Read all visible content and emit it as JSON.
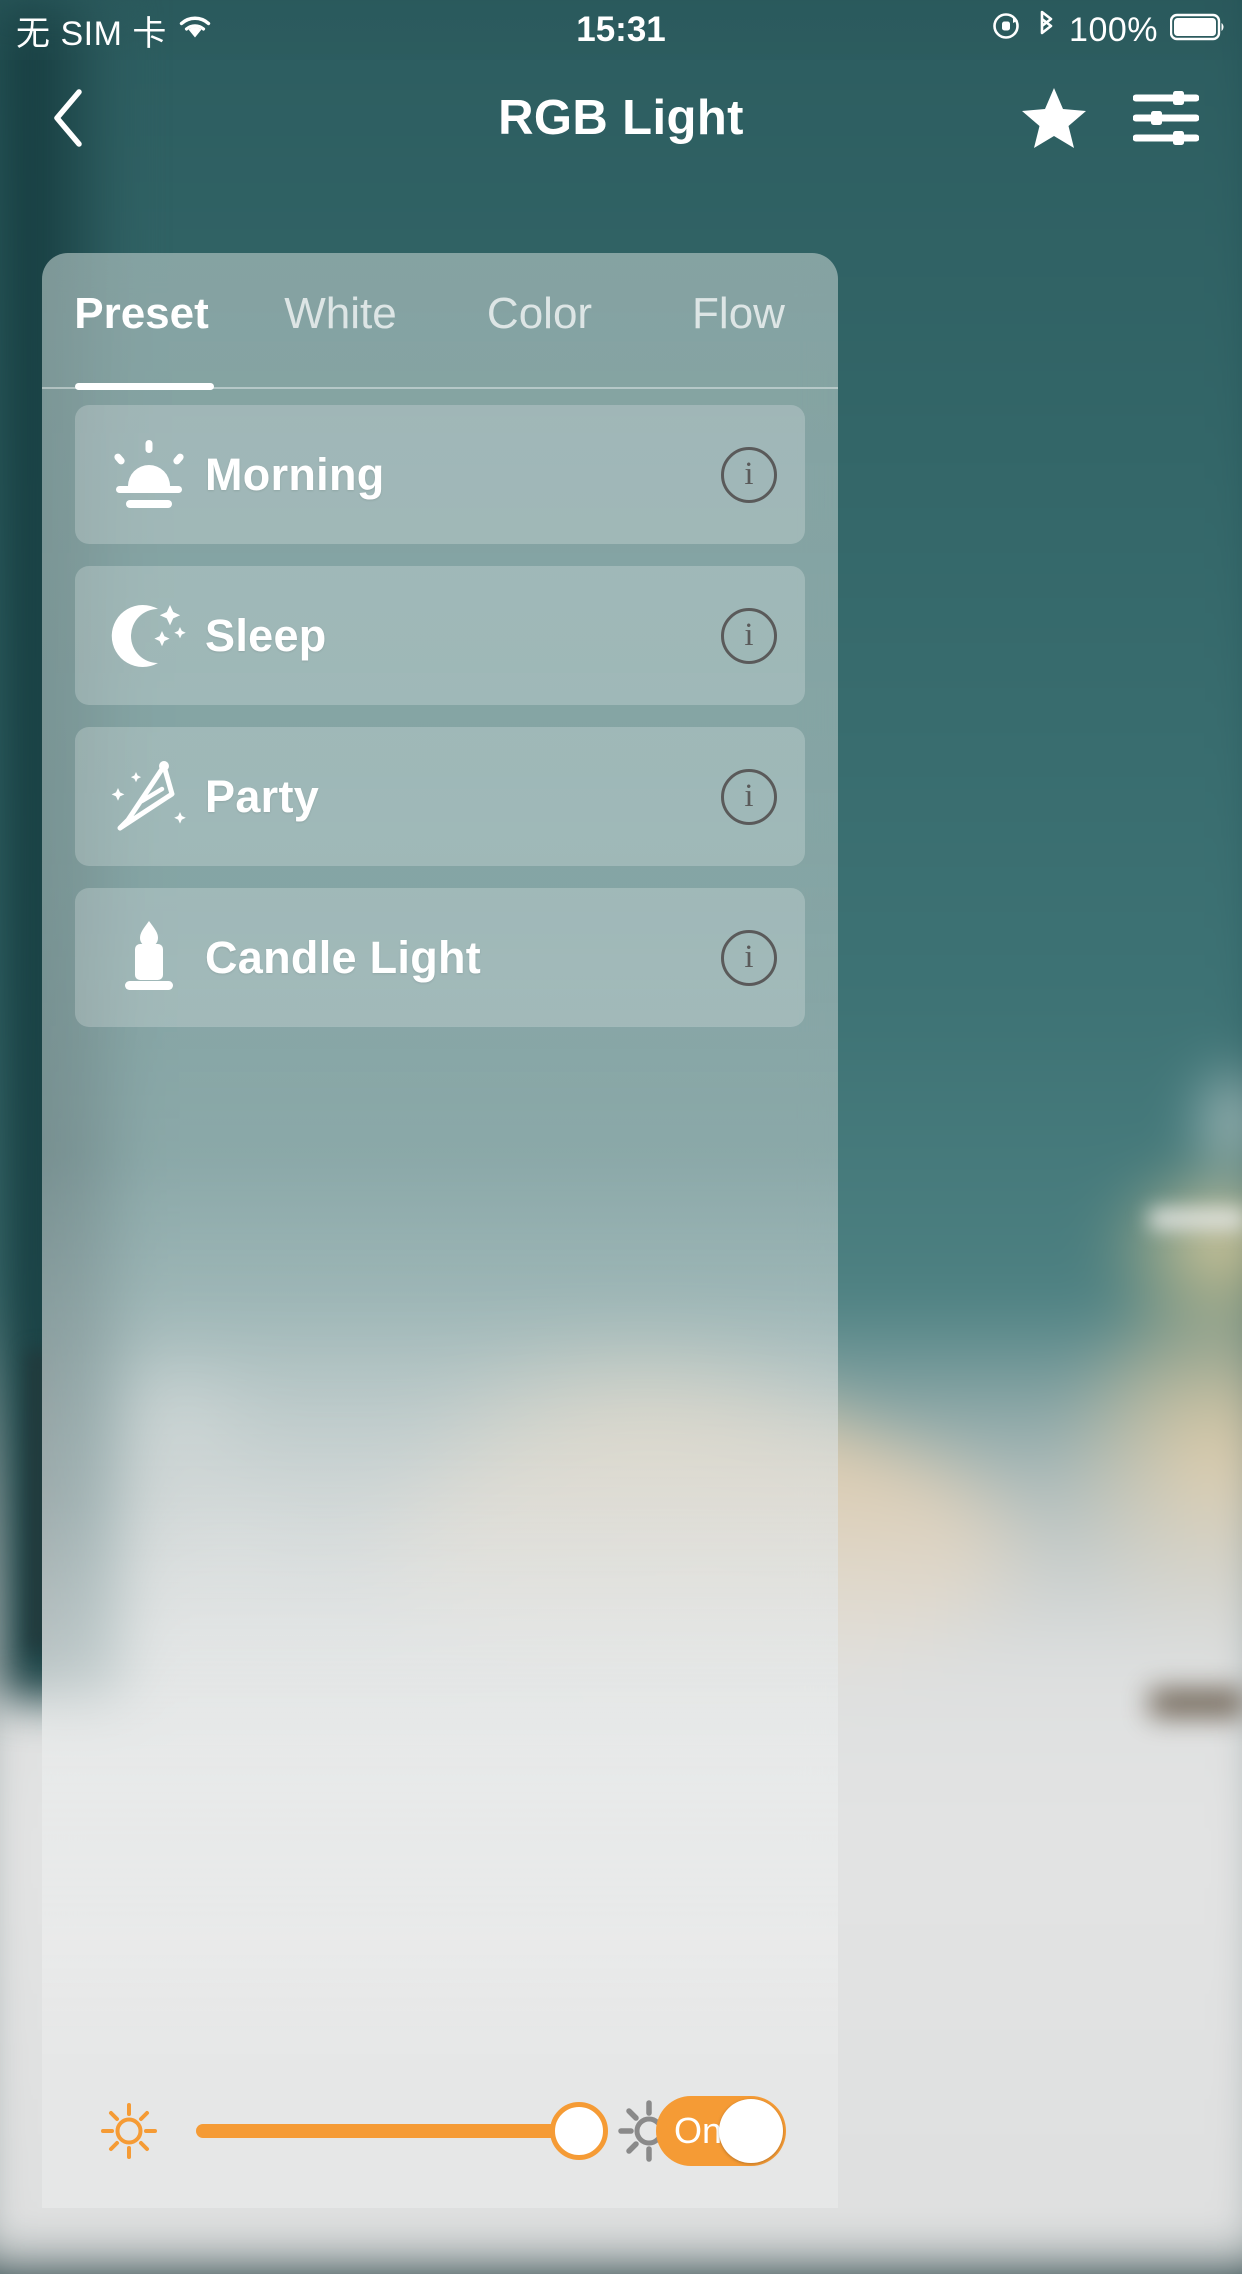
{
  "status_bar": {
    "carrier": "无 SIM 卡",
    "wifi_icon": "wifi-icon",
    "time": "15:31",
    "rotation_lock_icon": "rotation-lock-icon",
    "bluetooth_icon": "bluetooth-icon",
    "battery_percent": "100%",
    "battery_icon": "battery-full-icon"
  },
  "nav_bar": {
    "back_icon": "chevron-left-icon",
    "title": "RGB Light",
    "favorite_icon": "star-icon",
    "settings_icon": "sliders-icon"
  },
  "tabs": [
    {
      "label": "Preset",
      "active": true
    },
    {
      "label": "White",
      "active": false
    },
    {
      "label": "Color",
      "active": false
    },
    {
      "label": "Flow",
      "active": false
    }
  ],
  "presets": [
    {
      "label": "Morning",
      "icon": "sunrise-icon",
      "info_label": "i"
    },
    {
      "label": "Sleep",
      "icon": "moon-stars-icon",
      "info_label": "i"
    },
    {
      "label": "Party",
      "icon": "party-hat-icon",
      "info_label": "i"
    },
    {
      "label": "Candle Light",
      "icon": "candle-icon",
      "info_label": "i"
    }
  ],
  "control_bar": {
    "brightness_low_icon": "sun-small-icon",
    "brightness_high_icon": "sun-large-icon",
    "slider": {
      "value": 100,
      "min": 0,
      "max": 100
    },
    "power_label": "On",
    "power_on": true
  },
  "colors": {
    "accent_orange": "#f59b35",
    "panel_tint": "rgba(186,203,201,0.62)",
    "wall_teal": "#3d7274",
    "control_bar_bg": "#e6e7e7",
    "info_gray": "#5a5a5a"
  }
}
